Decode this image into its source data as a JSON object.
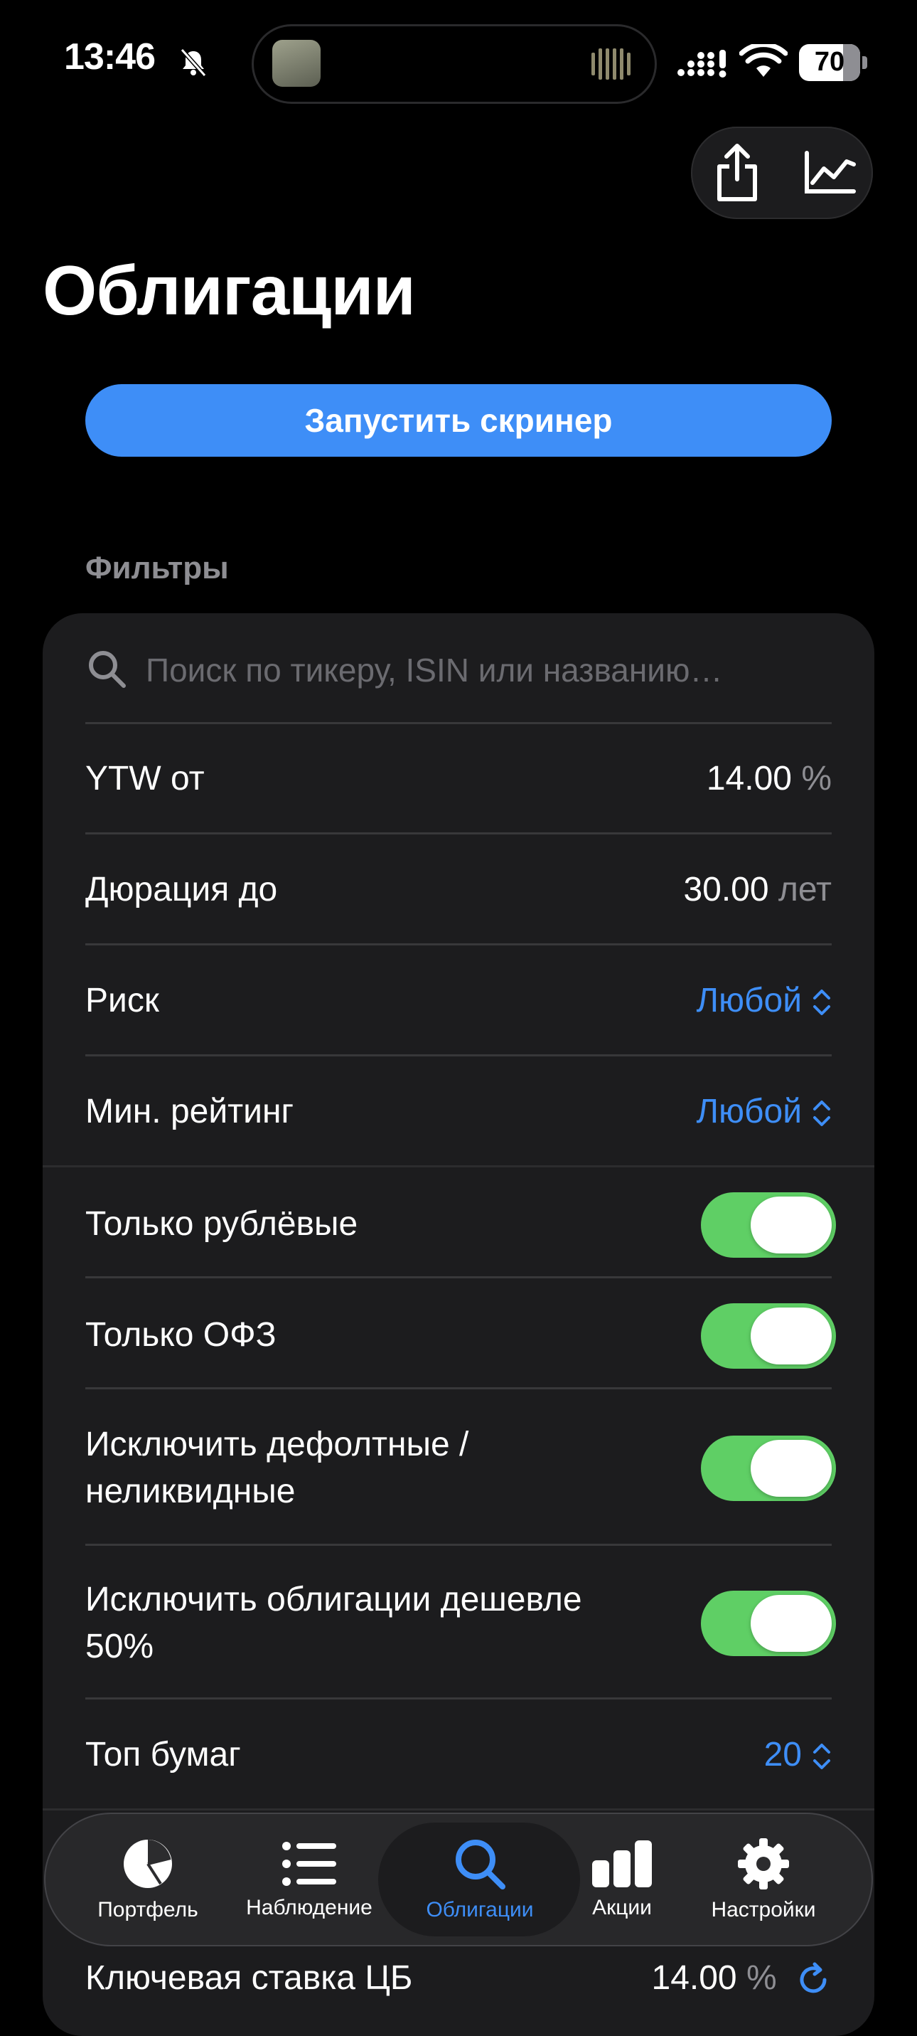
{
  "status": {
    "time": "13:46",
    "battery": "70"
  },
  "title": "Облигации",
  "run_button": "Запустить скринер",
  "filters_header": "Фильтры",
  "search": {
    "placeholder": "Поиск по тикеру, ISIN или названию…"
  },
  "rows": {
    "ytw": {
      "label": "YTW от",
      "value": "14.00",
      "unit": "%"
    },
    "duration": {
      "label": "Дюрация до",
      "value": "30.00",
      "unit": "лет"
    },
    "risk": {
      "label": "Риск",
      "value": "Любой"
    },
    "rating": {
      "label": "Мин. рейтинг",
      "value": "Любой"
    },
    "rub_only": {
      "label": "Только рублёвые",
      "on": true
    },
    "ofz_only": {
      "label": "Только ОФЗ",
      "on": true
    },
    "exclude_default": {
      "label_line1": "Исключить дефолтные /",
      "label_line2": "неликвидные",
      "on": true
    },
    "exclude_cheap": {
      "label_line1": "Исключить облигации дешевле",
      "label_line2": "50%",
      "on": true
    },
    "top": {
      "label": "Топ бумаг",
      "value": "20"
    },
    "key_rate": {
      "label": "Ключевая ставка ЦБ",
      "value": "14.00",
      "unit": "%"
    }
  },
  "tabs": [
    {
      "label": "Портфель",
      "icon": "pie-chart-icon"
    },
    {
      "label": "Наблюдение",
      "icon": "list-icon"
    },
    {
      "label": "Облигации",
      "icon": "search-icon",
      "active": true
    },
    {
      "label": "Акции",
      "icon": "bar-chart-icon"
    },
    {
      "label": "Настройки",
      "icon": "gear-icon"
    }
  ],
  "colors": {
    "accent": "#3e8ef7",
    "toggle_on": "#5fcf65",
    "card": "#1c1c1e"
  }
}
